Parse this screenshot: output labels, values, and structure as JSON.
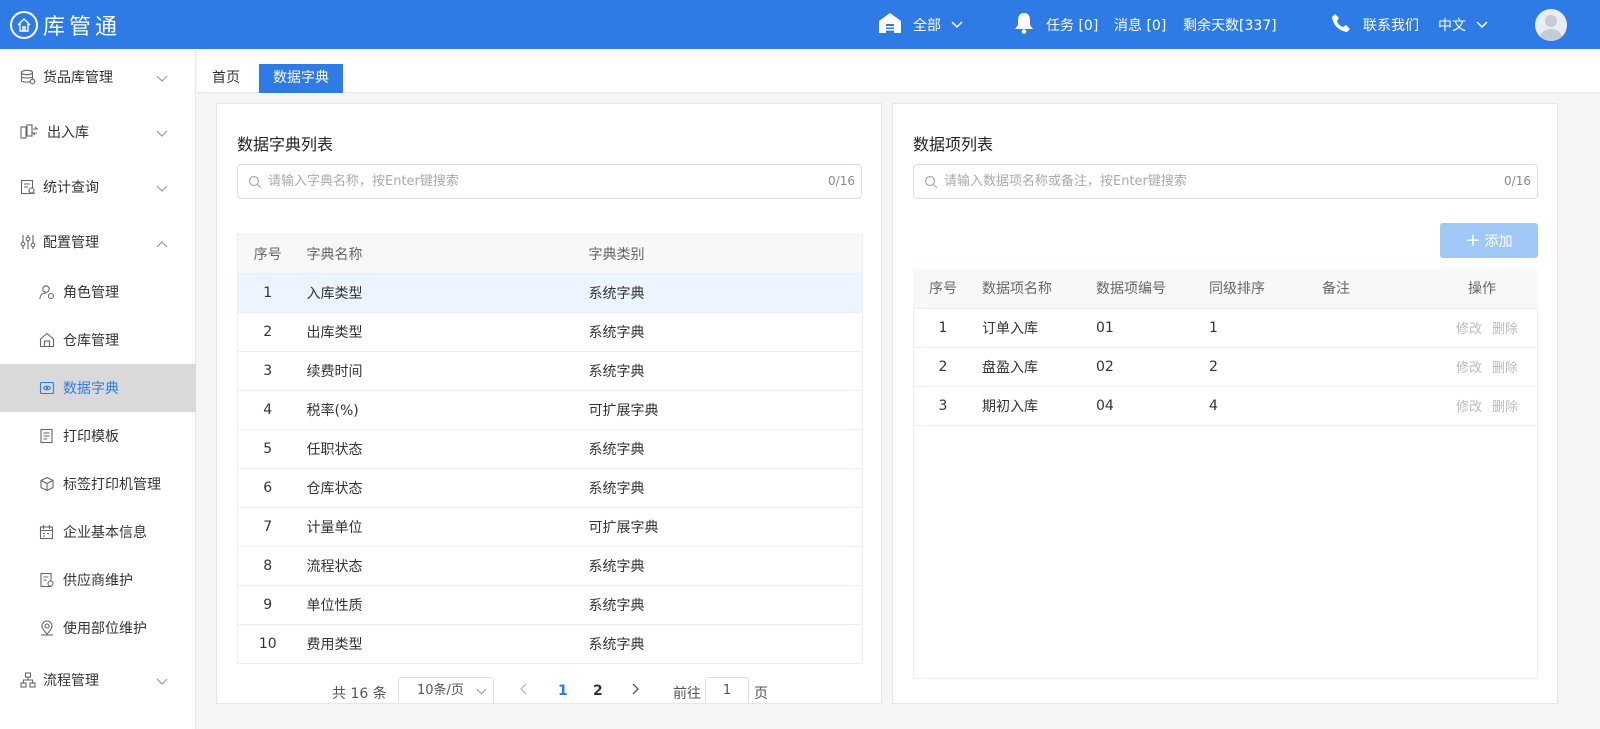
{
  "header": {
    "logo_text": "库管通",
    "warehouse_scope": "全部",
    "tasks": "任务 [0]",
    "messages": "消息 [0]",
    "remaining_days": "剩余天数[337]",
    "contact": "联系我们",
    "language": "中文",
    "colors": {
      "primary": "#2f7be5"
    }
  },
  "sidebar": {
    "items": [
      {
        "label": "货品库管理",
        "icon": "database-icon",
        "expanded": false
      },
      {
        "label": "出入库",
        "icon": "transfer-icon",
        "expanded": false
      },
      {
        "label": "统计查询",
        "icon": "report-icon",
        "expanded": false
      },
      {
        "label": "配置管理",
        "icon": "sliders-icon",
        "expanded": true,
        "children": [
          {
            "label": "角色管理",
            "icon": "user-gear-icon"
          },
          {
            "label": "仓库管理",
            "icon": "warehouse-icon"
          },
          {
            "label": "数据字典",
            "icon": "dictionary-icon",
            "active": true
          },
          {
            "label": "打印模板",
            "icon": "print-template-icon"
          },
          {
            "label": "标签打印机管理",
            "icon": "cube-icon"
          },
          {
            "label": "企业基本信息",
            "icon": "calendar-icon"
          },
          {
            "label": "供应商维护",
            "icon": "document-icon"
          },
          {
            "label": "使用部位维护",
            "icon": "location-icon"
          }
        ]
      },
      {
        "label": "流程管理",
        "icon": "flow-icon",
        "expanded": false
      }
    ]
  },
  "tabs": [
    {
      "label": "首页"
    },
    {
      "label": "数据字典",
      "active": true
    }
  ],
  "dict_panel": {
    "title": "数据字典列表",
    "search_placeholder": "请输入字典名称，按Enter键搜索",
    "search_count": "0/16",
    "columns": [
      "序号",
      "字典名称",
      "字典类别"
    ],
    "rows": [
      {
        "no": "1",
        "name": "入库类型",
        "category": "系统字典"
      },
      {
        "no": "2",
        "name": "出库类型",
        "category": "系统字典"
      },
      {
        "no": "3",
        "name": "续费时间",
        "category": "系统字典"
      },
      {
        "no": "4",
        "name": "税率(%)",
        "category": "可扩展字典"
      },
      {
        "no": "5",
        "name": "任职状态",
        "category": "系统字典"
      },
      {
        "no": "6",
        "name": "仓库状态",
        "category": "系统字典"
      },
      {
        "no": "7",
        "name": "计量单位",
        "category": "可扩展字典"
      },
      {
        "no": "8",
        "name": "流程状态",
        "category": "系统字典"
      },
      {
        "no": "9",
        "name": "单位性质",
        "category": "系统字典"
      },
      {
        "no": "10",
        "name": "费用类型",
        "category": "系统字典"
      }
    ],
    "selected_row": 1,
    "pagination": {
      "total": "共 16 条",
      "page_size": "10条/页",
      "pages": [
        "1",
        "2"
      ],
      "current_page": "1",
      "goto_label": "前往",
      "goto_value": "1",
      "page_unit": "页"
    }
  },
  "item_panel": {
    "title": "数据项列表",
    "search_placeholder": "请输入数据项名称或备注，按Enter键搜索",
    "search_count": "0/16",
    "add_label": "添加",
    "columns": [
      "序号",
      "数据项名称",
      "数据项编号",
      "同级排序",
      "备注",
      "操作"
    ],
    "rows": [
      {
        "no": "1",
        "name": "订单入库",
        "code": "01",
        "sort": "1",
        "remark": ""
      },
      {
        "no": "2",
        "name": "盘盈入库",
        "code": "02",
        "sort": "2",
        "remark": ""
      },
      {
        "no": "3",
        "name": "期初入库",
        "code": "04",
        "sort": "4",
        "remark": ""
      }
    ],
    "edit_label": "修改",
    "delete_label": "删除"
  }
}
